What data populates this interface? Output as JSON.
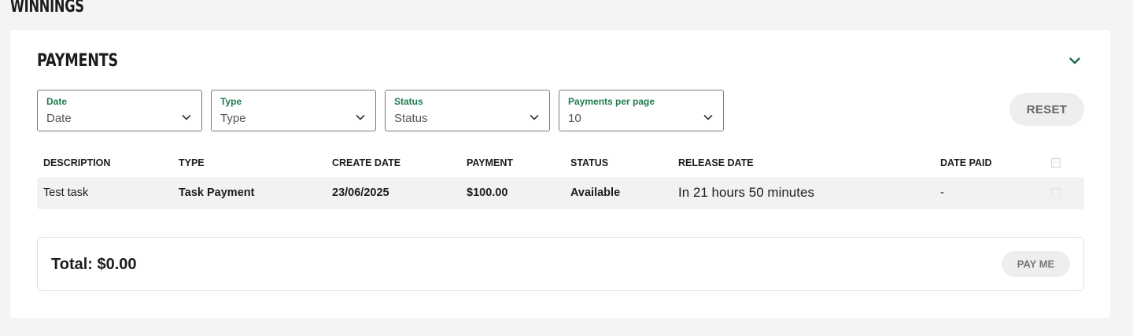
{
  "page": {
    "heading": "WINNINGS"
  },
  "payments": {
    "title": "PAYMENTS",
    "filters": [
      {
        "label": "Date",
        "value": "Date"
      },
      {
        "label": "Type",
        "value": "Type"
      },
      {
        "label": "Status",
        "value": "Status"
      },
      {
        "label": "Payments per page",
        "value": "10"
      }
    ],
    "reset_label": "RESET",
    "columns": [
      "DESCRIPTION",
      "TYPE",
      "CREATE DATE",
      "PAYMENT",
      "STATUS",
      "RELEASE DATE",
      "DATE PAID"
    ],
    "rows": [
      {
        "description": "Test task",
        "type": "Task Payment",
        "create_date": "23/06/2025",
        "payment": "$100.00",
        "status": "Available",
        "release_date": "In 21 hours 50 minutes",
        "date_paid": "-"
      }
    ],
    "total": "Total: $0.00",
    "pay_label": "PAY ME"
  },
  "colors": {
    "accent": "#1f7a4f",
    "text": "#1c1c1c",
    "button_bg": "#eeeeee"
  },
  "icons": {
    "collapse": "chevron-down-icon",
    "select": "chevron-down-icon"
  }
}
